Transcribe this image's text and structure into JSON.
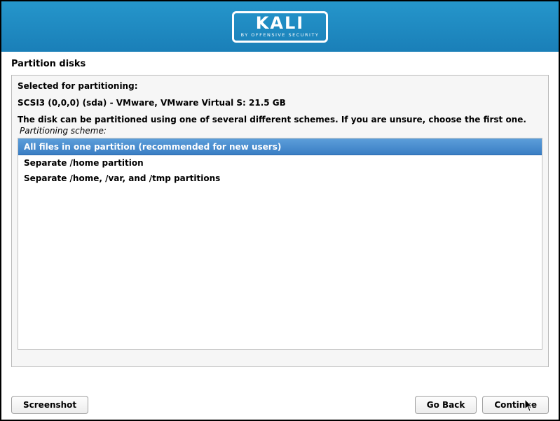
{
  "logo": {
    "main": "KALI",
    "sub": "BY OFFENSIVE SECURITY"
  },
  "page_title": "Partition disks",
  "panel": {
    "intro_label": "Selected for partitioning:",
    "disk_info": "SCSI3 (0,0,0) (sda) - VMware, VMware Virtual S: 21.5 GB",
    "instructions": "The disk can be partitioned using one of several different schemes. If you are unsure, choose the first one.",
    "scheme_label": "Partitioning scheme:",
    "options": [
      "All files in one partition (recommended for new users)",
      "Separate /home partition",
      "Separate /home, /var, and /tmp partitions"
    ],
    "selected_index": 0
  },
  "buttons": {
    "screenshot": "Screenshot",
    "go_back": "Go Back",
    "continue": "Continue"
  }
}
